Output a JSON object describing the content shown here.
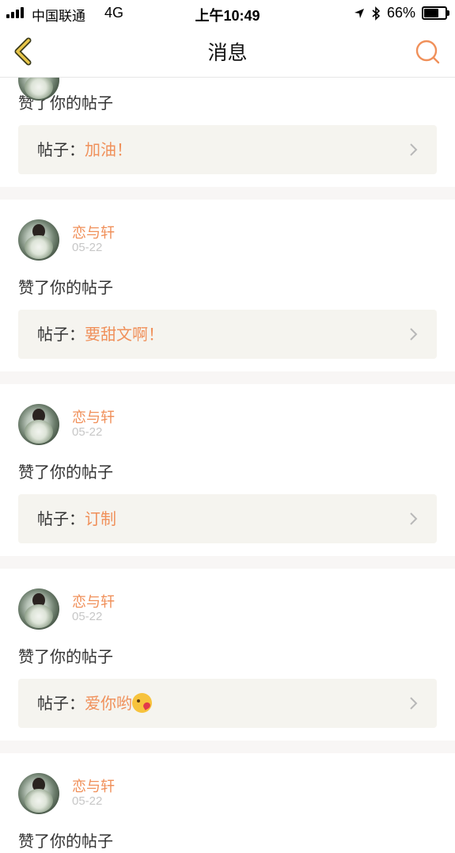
{
  "status_bar": {
    "carrier": "中国联通",
    "network": "4G",
    "time": "上午10:49",
    "battery_percent": "66%",
    "battery_level": 0.66,
    "icons": [
      "signal-icon",
      "location-icon",
      "bluetooth-icon",
      "battery-icon"
    ]
  },
  "navbar": {
    "title": "消息",
    "back_icon": "chevron-left-icon",
    "search_icon": "search-icon",
    "accent_color": "#f0905a"
  },
  "post_label": "帖子：",
  "action_text": "赞了你的帖子",
  "top_partial": {
    "action": "赞了你的帖子",
    "post_title": "加油！"
  },
  "items": [
    {
      "user": "恋与轩",
      "date": "05-22",
      "action": "赞了你的帖子",
      "post_title": "要甜文啊！"
    },
    {
      "user": "恋与轩",
      "date": "05-22",
      "action": "赞了你的帖子",
      "post_title": "订制"
    },
    {
      "user": "恋与轩",
      "date": "05-22",
      "action": "赞了你的帖子",
      "post_title": "爱你哟",
      "post_emoji": "kissing-face-emoji"
    },
    {
      "user": "恋与轩",
      "date": "05-22",
      "action": "赞了你的帖子"
    }
  ]
}
